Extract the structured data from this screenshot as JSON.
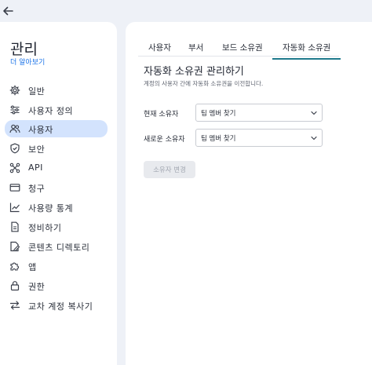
{
  "sidebar": {
    "title": "관리",
    "learn_more": "더 알아보기",
    "items": [
      {
        "label": "일반",
        "icon": "gear-icon",
        "active": false
      },
      {
        "label": "사용자 정의",
        "icon": "sliders-icon",
        "active": false
      },
      {
        "label": "사용자",
        "icon": "users-icon",
        "active": true
      },
      {
        "label": "보안",
        "icon": "shield-icon",
        "active": false
      },
      {
        "label": "API",
        "icon": "nodes-icon",
        "active": false
      },
      {
        "label": "청구",
        "icon": "card-icon",
        "active": false
      },
      {
        "label": "사용량 통계",
        "icon": "chart-icon",
        "active": false
      },
      {
        "label": "정비하기",
        "icon": "document-icon",
        "active": false
      },
      {
        "label": "콘텐츠 디렉토리",
        "icon": "folder-edit-icon",
        "active": false
      },
      {
        "label": "앱",
        "icon": "puzzle-icon",
        "active": false
      },
      {
        "label": "권한",
        "icon": "lock-icon",
        "active": false
      },
      {
        "label": "교차 계정 복사기",
        "icon": "transfer-icon",
        "active": false
      }
    ]
  },
  "tabs": [
    {
      "label": "사용자",
      "active": false
    },
    {
      "label": "부서",
      "active": false
    },
    {
      "label": "보드 소유권",
      "active": false
    },
    {
      "label": "자동화 소유권",
      "active": true
    }
  ],
  "section": {
    "title": "자동화 소유권 관리하기",
    "description": "계정의 사용자 간에 자동화 소유권을 이전합니다."
  },
  "form": {
    "current_owner_label": "현재 소유자",
    "current_owner_value": "팀 멤버 찾기",
    "new_owner_label": "새로운 소유자",
    "new_owner_value": "팀 멤버 찾기",
    "submit_label": "소유자 변경"
  },
  "colors": {
    "accent": "#1f7a8c",
    "active_bg": "#d3e3fd",
    "link": "#1a73e8"
  }
}
